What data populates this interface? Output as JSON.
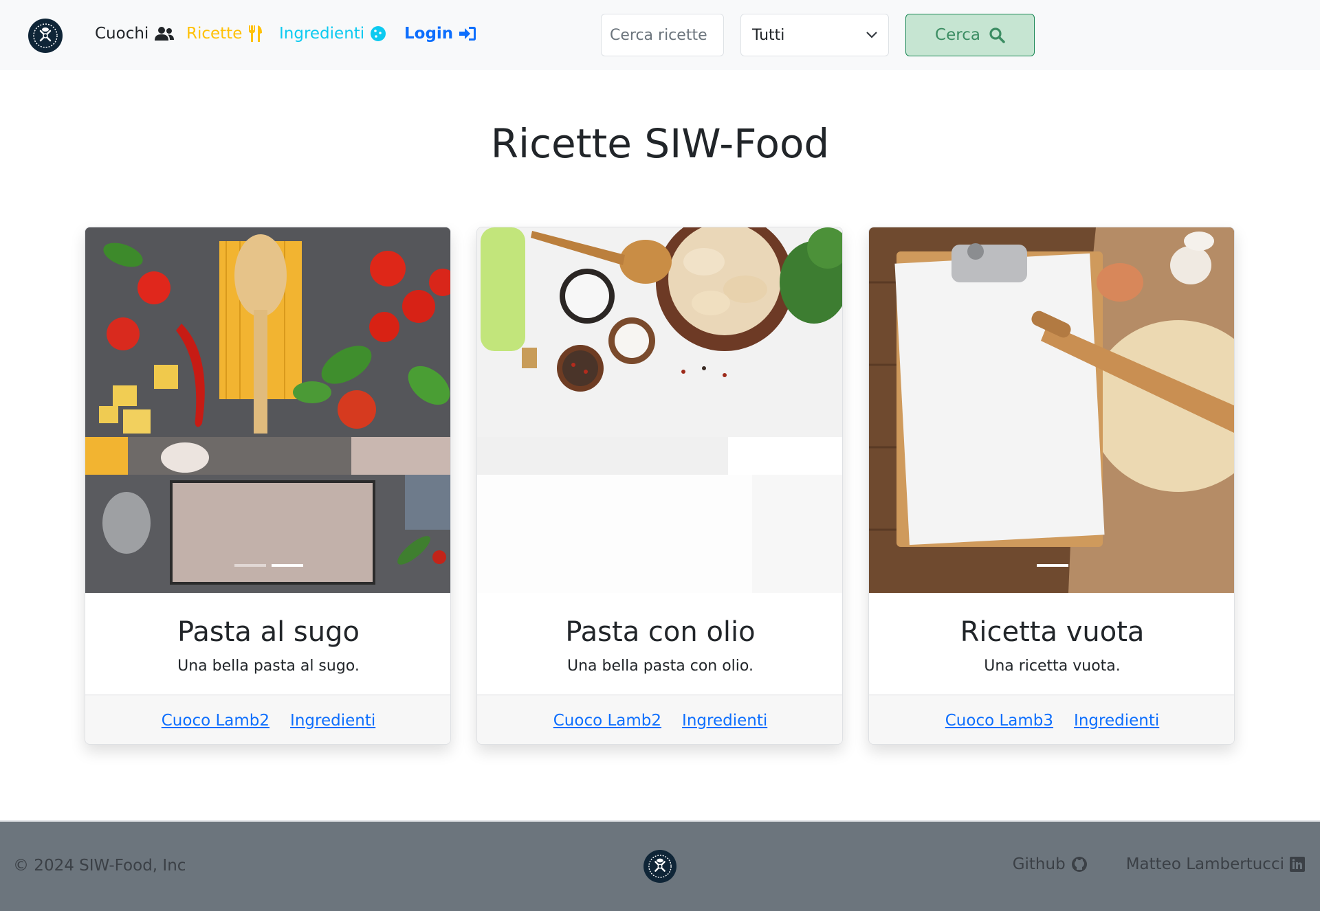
{
  "nav": {
    "items": [
      {
        "label": "Cuochi",
        "icon": "users-icon",
        "color": "#212529"
      },
      {
        "label": "Ricette",
        "icon": "utensils-icon",
        "color": "#ffc107"
      },
      {
        "label": "Ingredienti",
        "icon": "cookie-icon",
        "color": "#0dcaf0"
      },
      {
        "label": "Login",
        "icon": "sign-in-icon",
        "color": "#0d6efd"
      }
    ]
  },
  "search": {
    "placeholder": "Cerca ricette",
    "filter_value": "Tutti",
    "button_label": "Cerca"
  },
  "main": {
    "title": "Ricette SIW-Food"
  },
  "recipes": [
    {
      "title": "Pasta al sugo",
      "description": "Una bella pasta al sugo.",
      "cook_link": "Cuoco Lamb2",
      "ingredients_link": "Ingredienti"
    },
    {
      "title": "Pasta con olio",
      "description": "Una bella pasta con olio.",
      "cook_link": "Cuoco Lamb2",
      "ingredients_link": "Ingredienti"
    },
    {
      "title": "Ricetta vuota",
      "description": "Una ricetta vuota.",
      "cook_link": "Cuoco Lamb3",
      "ingredients_link": "Ingredienti"
    }
  ],
  "footer": {
    "copyright": "© 2024 SIW-Food, Inc",
    "github_label": "Github",
    "author_label": "Matteo Lambertucci"
  },
  "colors": {
    "navbar_bg": "#f8f9fa",
    "footer_bg": "#6c757d",
    "link": "#0d6efd",
    "success": "#198754"
  }
}
